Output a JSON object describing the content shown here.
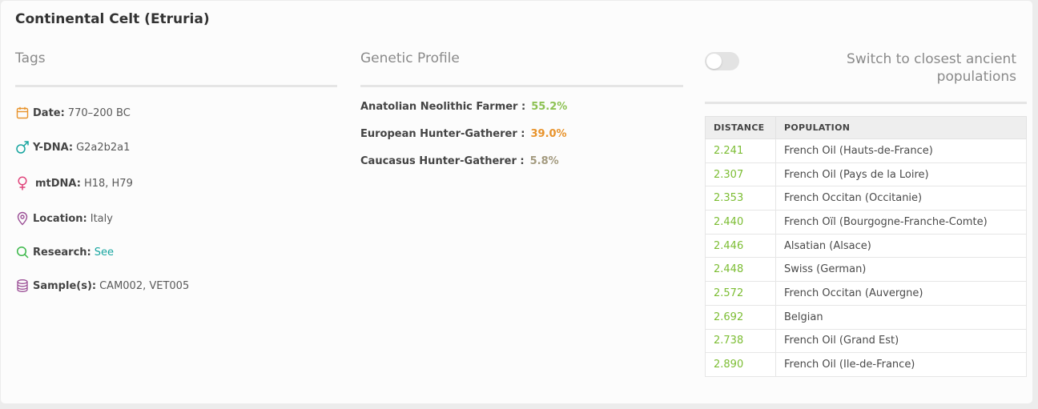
{
  "title": "Continental Celt (Etruria)",
  "tags": {
    "heading": "Tags",
    "date": {
      "label": "Date:",
      "value": "770–200 BC"
    },
    "ydna": {
      "label": "Y-DNA:",
      "value": "G2a2b2a1"
    },
    "mtdna": {
      "label": "mtDNA:",
      "value": "H18, H79"
    },
    "location": {
      "label": "Location:",
      "value": "Italy"
    },
    "research": {
      "label": "Research:",
      "link": "See"
    },
    "samples": {
      "label": "Sample(s):",
      "value": "CAM002, VET005"
    }
  },
  "genetic_profile": {
    "heading": "Genetic Profile",
    "items": [
      {
        "name": "Anatolian Neolithic Farmer :",
        "pct": "55.2%",
        "color": "#8cc152"
      },
      {
        "name": "European Hunter-Gatherer :",
        "pct": "39.0%",
        "color": "#e8932b"
      },
      {
        "name": "Caucasus Hunter-Gatherer :",
        "pct": "5.8%",
        "color": "#a39a7f"
      }
    ]
  },
  "ancient_toggle": {
    "label": "Switch to closest ancient populations",
    "enabled": false
  },
  "distance_table": {
    "headers": [
      "DISTANCE",
      "POPULATION"
    ],
    "rows": [
      {
        "distance": "2.241",
        "population": "French Oil (Hauts-de-France)"
      },
      {
        "distance": "2.307",
        "population": "French Oil (Pays de la Loire)"
      },
      {
        "distance": "2.353",
        "population": "French Occitan (Occitanie)"
      },
      {
        "distance": "2.440",
        "population": "French Oïl (Bourgogne-Franche-Comte)"
      },
      {
        "distance": "2.446",
        "population": "Alsatian (Alsace)"
      },
      {
        "distance": "2.448",
        "population": "Swiss (German)"
      },
      {
        "distance": "2.572",
        "population": "French Occitan (Auvergne)"
      },
      {
        "distance": "2.692",
        "population": "Belgian"
      },
      {
        "distance": "2.738",
        "population": "French Oil (Grand Est)"
      },
      {
        "distance": "2.890",
        "population": "French Oil (Ile-de-France)"
      }
    ]
  },
  "colors": {
    "distance_green": "#7cbd33",
    "link_teal": "#17a59f",
    "date_icon": "#e8932b",
    "ydna_icon": "#17a59f",
    "mtdna_icon": "#e0457b",
    "location_icon": "#9b4f96",
    "research_icon": "#3cb84a",
    "samples_icon": "#9b4f96"
  },
  "icons": [
    "calendar-icon",
    "male-symbol-icon",
    "female-symbol-icon",
    "map-pin-icon",
    "search-icon",
    "database-icon"
  ]
}
